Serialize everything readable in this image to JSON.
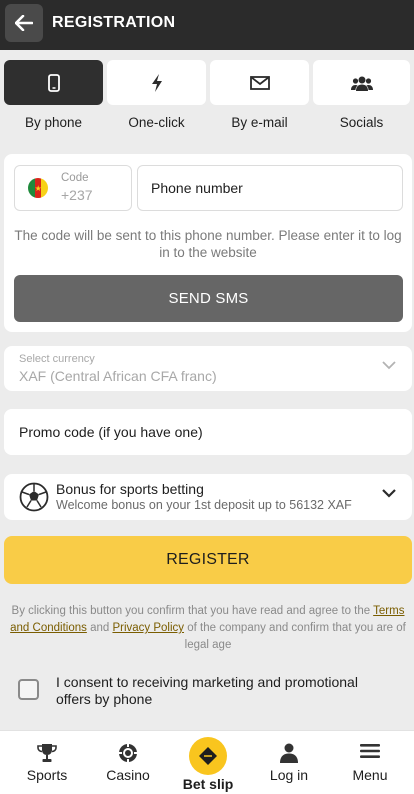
{
  "header": {
    "title": "REGISTRATION",
    "back_icon": "arrow-left-icon"
  },
  "methods": [
    {
      "label": "By phone",
      "icon": "smartphone-icon",
      "active": true
    },
    {
      "label": "One-click",
      "icon": "lightning-icon",
      "active": false
    },
    {
      "label": "By e-mail",
      "icon": "envelope-icon",
      "active": false
    },
    {
      "label": "Socials",
      "icon": "people-icon",
      "active": false
    }
  ],
  "phone_form": {
    "code_label": "Code",
    "code_value": "+237",
    "phone_placeholder": "Phone number",
    "hint": "The code will be sent to this phone number. Please enter it to log in to the website",
    "send_button": "SEND SMS"
  },
  "currency": {
    "label": "Select currency",
    "value": "XAF  (Central African CFA franc)"
  },
  "promo": {
    "placeholder": "Promo code (if you have one)"
  },
  "bonus": {
    "title": "Bonus for sports betting",
    "subtitle": "Welcome bonus on your 1st deposit up to 56132 XAF"
  },
  "register_button": "REGISTER",
  "legal": {
    "prefix": "By clicking this button you confirm that you have read and agree to the ",
    "terms_link": "Terms and Conditions",
    "and": " and ",
    "privacy_link": "Privacy Policy",
    "suffix": " of the company and confirm that you are of legal age"
  },
  "consent": {
    "text": "I consent to receiving marketing and promotional offers by phone",
    "checked": false
  },
  "bottom_nav": [
    {
      "label": "Sports",
      "icon": "trophy-icon"
    },
    {
      "label": "Casino",
      "icon": "casino-chip-icon"
    },
    {
      "label": "Bet slip",
      "icon": "ticket-icon"
    },
    {
      "label": "Log in",
      "icon": "user-icon"
    },
    {
      "label": "Menu",
      "icon": "hamburger-icon"
    }
  ],
  "colors": {
    "accent": "#f9cc47",
    "header": "#2b2b2b",
    "sms_button": "#666666"
  }
}
